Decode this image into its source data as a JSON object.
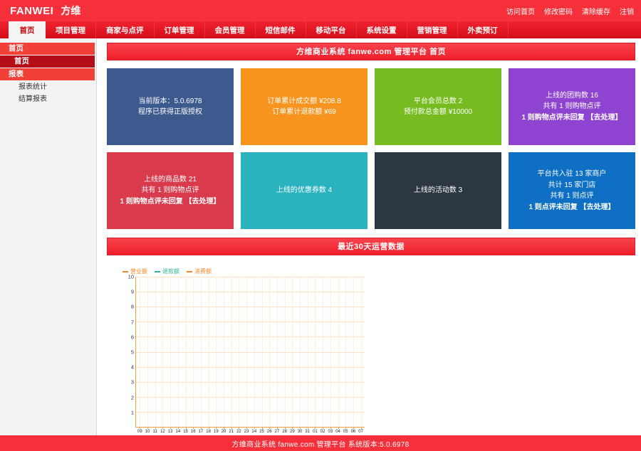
{
  "header": {
    "brand_en": "FANWEI",
    "brand_cn": "方维",
    "links": [
      {
        "label": "访问首页",
        "name": "visit-home"
      },
      {
        "label": "修改密码",
        "name": "change-password"
      },
      {
        "label": "清除缓存",
        "name": "clear-cache"
      },
      {
        "label": "注销",
        "name": "logout"
      }
    ]
  },
  "nav": {
    "items": [
      {
        "label": "首页",
        "active": true
      },
      {
        "label": "项目管理",
        "active": false
      },
      {
        "label": "商家与点评",
        "active": false
      },
      {
        "label": "订单管理",
        "active": false
      },
      {
        "label": "会员管理",
        "active": false
      },
      {
        "label": "短信邮件",
        "active": false
      },
      {
        "label": "移动平台",
        "active": false
      },
      {
        "label": "系统设置",
        "active": false
      },
      {
        "label": "营销管理",
        "active": false
      },
      {
        "label": "外卖预订",
        "active": false
      }
    ]
  },
  "sidebar": {
    "groups": [
      {
        "head": "首页",
        "items": [
          {
            "label": "首页",
            "selected": true
          }
        ]
      },
      {
        "head": "报表",
        "items": [
          {
            "label": "报表统计",
            "selected": false
          },
          {
            "label": "结算报表",
            "selected": false
          }
        ]
      }
    ]
  },
  "main": {
    "panel_title": "方维商业系统 fanwe.com 管理平台 首页",
    "chart_panel_title": "最近30天运营数据",
    "cards": [
      {
        "name": "version-card",
        "color": "#3d5a8f",
        "lines": [
          "当前版本：5.0.6978",
          "程序已获得正版授权"
        ],
        "action": null
      },
      {
        "name": "order-amount-card",
        "color": "#f7941d",
        "lines": [
          "订单累计成交额 ¥208.8",
          "订单累计退款额 ¥69"
        ],
        "action": null
      },
      {
        "name": "member-total-card",
        "color": "#76bc21",
        "lines": [
          "平台会员总数 2",
          "预付款总金额 ¥10000"
        ],
        "action": null
      },
      {
        "name": "groupbuy-card",
        "color": "#8e44d0",
        "lines": [
          "上线的团购数 16",
          "共有 1 则购物点评"
        ],
        "action": "1 则购物点评未回复 【去处理】"
      },
      {
        "name": "goods-card",
        "color": "#d93b4c",
        "lines": [
          "上线的商品数 21",
          "共有 1 则购物点评"
        ],
        "action": "1 则购物点评未回复 【去处理】"
      },
      {
        "name": "coupon-card",
        "color": "#2bb2bf",
        "lines": [
          "上线的优惠券数 4"
        ],
        "action": null
      },
      {
        "name": "activity-card",
        "color": "#2c3741",
        "lines": [
          "上线的活动数 3"
        ],
        "action": null
      },
      {
        "name": "merchant-card",
        "color": "#0e6fc4",
        "lines": [
          "平台共入驻 13 家商户",
          "共计 15 家门店",
          "共有 1 则点评"
        ],
        "action": "1 则点评未回复 【去处理】"
      }
    ]
  },
  "chart_data": {
    "type": "line",
    "title": "最近30天运营数据",
    "xlabel": "",
    "ylabel": "",
    "grid": true,
    "legend_position": "top-left",
    "ylim": [
      0,
      10
    ],
    "yticks": [
      "10",
      "9",
      "8",
      "7",
      "6",
      "5",
      "4",
      "3",
      "2",
      "1"
    ],
    "categories": [
      "09",
      "10",
      "11",
      "12",
      "13",
      "14",
      "15",
      "16",
      "17",
      "18",
      "19",
      "20",
      "21",
      "22",
      "23",
      "24",
      "25",
      "26",
      "27",
      "28",
      "29",
      "30",
      "31",
      "01",
      "02",
      "03",
      "04",
      "05",
      "06",
      "07"
    ],
    "series": [
      {
        "name": "营业额",
        "color": "#f0882a",
        "values": [
          0,
          0,
          0,
          0,
          0,
          0,
          0,
          0,
          0,
          0,
          0,
          0,
          0,
          0,
          0,
          0,
          0,
          0,
          0,
          0,
          0,
          0,
          0,
          0,
          0,
          0,
          0,
          0,
          0,
          0
        ]
      },
      {
        "name": "退款额",
        "color": "#2bb2a0",
        "values": [
          0,
          0,
          0,
          0,
          0,
          0,
          0,
          0,
          0,
          0,
          0,
          0,
          0,
          0,
          0,
          0,
          0,
          0,
          0,
          0,
          0,
          0,
          0,
          0,
          0,
          0,
          0,
          0,
          0,
          0
        ]
      },
      {
        "name": "消费额",
        "color": "#f0882a",
        "values": [
          0,
          0,
          0,
          0,
          0,
          0,
          0,
          0,
          0,
          0,
          0,
          0,
          0,
          0,
          0,
          0,
          0,
          0,
          0,
          0,
          0,
          0,
          0,
          0,
          0,
          0,
          0,
          0,
          0,
          0
        ]
      }
    ]
  },
  "footer": {
    "text": "方维商业系统 fanwe.com 管理平台 系统版本:5.0.6978"
  }
}
